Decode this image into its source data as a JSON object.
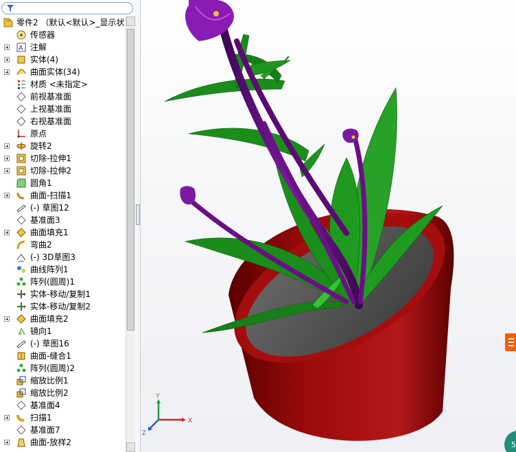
{
  "feature_tree": {
    "root_label": "零件2 （默认<默认>_显示状",
    "items": [
      {
        "label": "传感器",
        "icon": "sensor-icon",
        "expandable": false
      },
      {
        "label": "注解",
        "icon": "annotation-icon",
        "expandable": true
      },
      {
        "label": "实体(4)",
        "icon": "solid-body-icon",
        "expandable": true
      },
      {
        "label": "曲面实体(34)",
        "icon": "surface-body-icon",
        "expandable": true
      },
      {
        "label": "材质 <未指定>",
        "icon": "material-icon",
        "expandable": false
      },
      {
        "label": "前视基准面",
        "icon": "plane-icon",
        "expandable": false
      },
      {
        "label": "上视基准面",
        "icon": "plane-icon",
        "expandable": false
      },
      {
        "label": "右视基准面",
        "icon": "plane-icon",
        "expandable": false
      },
      {
        "label": "原点",
        "icon": "origin-icon",
        "expandable": false
      },
      {
        "label": "旋转2",
        "icon": "revolve-icon",
        "expandable": true
      },
      {
        "label": "切除-拉伸1",
        "icon": "cut-extrude-icon",
        "expandable": true
      },
      {
        "label": "切除-拉伸2",
        "icon": "cut-extrude-icon",
        "expandable": true
      },
      {
        "label": "圆角1",
        "icon": "fillet-icon",
        "expandable": false
      },
      {
        "label": "曲面-扫描1",
        "icon": "surface-sweep-icon",
        "expandable": true
      },
      {
        "label": "(-) 草图12",
        "icon": "sketch-icon",
        "expandable": false
      },
      {
        "label": "基准面3",
        "icon": "plane-icon",
        "expandable": false
      },
      {
        "label": "曲面填充1",
        "icon": "surface-fill-icon",
        "expandable": true
      },
      {
        "label": "弯曲2",
        "icon": "flex-icon",
        "expandable": false
      },
      {
        "label": "(-) 3D草图3",
        "icon": "sketch-3d-icon",
        "expandable": false
      },
      {
        "label": "曲线阵列1",
        "icon": "curve-pattern-icon",
        "expandable": false
      },
      {
        "label": "阵列(圆周)1",
        "icon": "circular-pattern-icon",
        "expandable": false
      },
      {
        "label": "实体-移动/复制1",
        "icon": "move-copy-icon",
        "expandable": false
      },
      {
        "label": "实体-移动/复制2",
        "icon": "move-copy-icon",
        "expandable": false
      },
      {
        "label": "曲面填充2",
        "icon": "surface-fill-icon",
        "expandable": true
      },
      {
        "label": "镜向1",
        "icon": "mirror-icon",
        "expandable": false
      },
      {
        "label": "(-) 草图16",
        "icon": "sketch-icon",
        "expandable": false
      },
      {
        "label": "曲面-缝合1",
        "icon": "surface-knit-icon",
        "expandable": false
      },
      {
        "label": "阵列(圆周)2",
        "icon": "circular-pattern-icon",
        "expandable": false
      },
      {
        "label": "缩放比例1",
        "icon": "scale-icon",
        "expandable": false
      },
      {
        "label": "缩放比例2",
        "icon": "scale-icon",
        "expandable": false
      },
      {
        "label": "基准面4",
        "icon": "plane-icon",
        "expandable": false
      },
      {
        "label": "扫描1",
        "icon": "sweep-icon",
        "expandable": true
      },
      {
        "label": "基准面7",
        "icon": "plane-icon",
        "expandable": false
      },
      {
        "label": "曲面-放样2",
        "icon": "surface-loft-icon",
        "expandable": true
      }
    ]
  },
  "triad": {
    "x_label": "X",
    "y_label": "Y",
    "z_label": "Z"
  },
  "corner_badge": {
    "text": "5"
  },
  "colors": {
    "pot_red": "#9b0a0a",
    "soil_gray": "#4d4d4d",
    "leaf_green": "#1c8a1c",
    "stem_purple": "#6a0f84",
    "flower_violet": "#8a1bb5",
    "logo_orange": "#ff5a00"
  }
}
